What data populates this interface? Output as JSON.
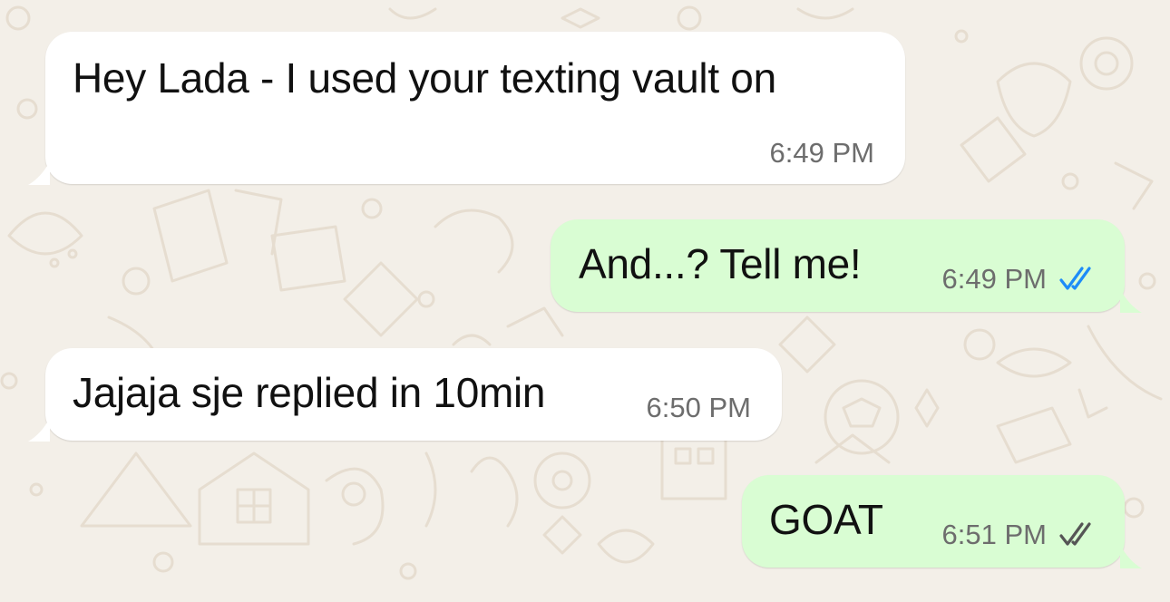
{
  "chat": {
    "messages": [
      {
        "direction": "incoming",
        "text": "Hey Lada - I used your texting vault on",
        "time": "6:49 PM"
      },
      {
        "direction": "outgoing",
        "text": "And...? Tell me!",
        "time": "6:49 PM",
        "status": "read",
        "tick_color": "#1d8cf8"
      },
      {
        "direction": "incoming",
        "text": "Jajaja sje replied in 10min",
        "time": "6:50 PM"
      },
      {
        "direction": "outgoing",
        "text": "GOAT",
        "time": "6:51 PM",
        "status": "delivered",
        "tick_color": "#555555"
      }
    ]
  },
  "colors": {
    "wallpaper": "#f3efe8",
    "incoming_bubble": "#ffffff",
    "outgoing_bubble": "#d9fdd3",
    "read_tick": "#1d8cf8"
  },
  "icons": [
    "double-check-read-icon",
    "double-check-delivered-icon"
  ]
}
